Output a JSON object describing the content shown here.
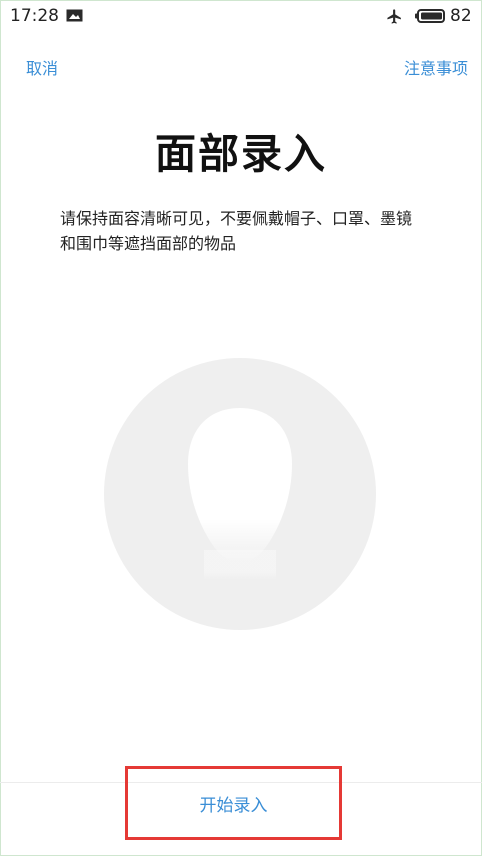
{
  "status_bar": {
    "time": "17:28",
    "battery_level": "82",
    "icons": [
      "image-notification-icon",
      "airplane-mode-icon",
      "battery-icon"
    ]
  },
  "header": {
    "cancel_label": "取消",
    "notes_label": "注意事项"
  },
  "main": {
    "title": "面部录入",
    "instruction": "请保持面容清晰可见，不要佩戴帽子、口罩、墨镜和围巾等遮挡面部的物品"
  },
  "footer": {
    "start_label": "开始录入"
  },
  "colors": {
    "accent": "#3a8ed6",
    "highlight_border": "#e53935",
    "illustration_bg": "#efefef"
  }
}
